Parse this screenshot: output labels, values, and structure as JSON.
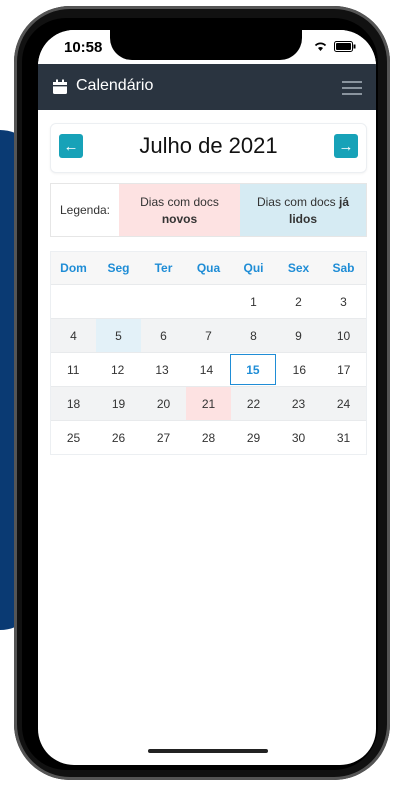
{
  "status_bar": {
    "time": "10:58"
  },
  "app_bar": {
    "title": "Calendário"
  },
  "calendar_nav": {
    "prev_label": "←",
    "month_title": "Julho de 2021",
    "next_label": "→"
  },
  "legend": {
    "label": "Legenda:",
    "new_line1": "Dias com docs",
    "new_line2": "novos",
    "read_line1a": "Dias com docs",
    "read_line1b": "já",
    "read_line2": "lidos"
  },
  "weekdays": [
    "Dom",
    "Seg",
    "Ter",
    "Qua",
    "Qui",
    "Sex",
    "Sab"
  ],
  "weeks": [
    [
      "",
      "",
      "",
      "",
      "1",
      "2",
      "3"
    ],
    [
      "4",
      "5",
      "6",
      "7",
      "8",
      "9",
      "10"
    ],
    [
      "11",
      "12",
      "13",
      "14",
      "15",
      "16",
      "17"
    ],
    [
      "18",
      "19",
      "20",
      "21",
      "22",
      "23",
      "24"
    ],
    [
      "25",
      "26",
      "27",
      "28",
      "29",
      "30",
      "31"
    ]
  ],
  "highlights": {
    "read_days": [
      "5"
    ],
    "new_days": [
      "21"
    ],
    "today": "15"
  },
  "colors": {
    "appbar": "#2a3440",
    "accent": "#17a2b8",
    "weekday_text": "#1f8dd6",
    "new_bg": "#fde2e2",
    "read_bg": "#d6ebf3"
  }
}
